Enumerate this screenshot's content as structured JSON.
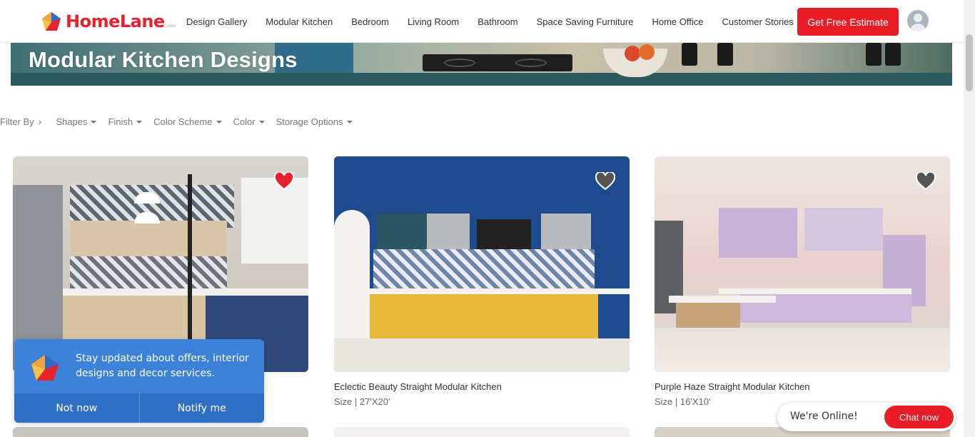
{
  "header": {
    "logo_text": "HomeLane",
    "logo_sub": ".com",
    "nav": [
      "Design Gallery",
      "Modular Kitchen",
      "Bedroom",
      "Living Room",
      "Bathroom",
      "Space Saving Furniture",
      "Home Office",
      "Customer Stories"
    ],
    "cta_label": "Get Free Estimate"
  },
  "hero": {
    "title": "Modular Kitchen Designs"
  },
  "filters": {
    "label": "Filter By",
    "items": [
      "Shapes",
      "Finish",
      "Color Scheme",
      "Color",
      "Storage Options"
    ]
  },
  "cards": [
    {
      "title": "",
      "size": "",
      "favorited": true
    },
    {
      "title": "Eclectic Beauty Straight Modular Kitchen",
      "size": "Size | 27'X20'",
      "favorited": false
    },
    {
      "title": "Purple Haze Straight Modular Kitchen",
      "size": "Size | 16'X10'",
      "favorited": false
    }
  ],
  "notification": {
    "message": "Stay updated about offers, interior designs and decor services.",
    "decline_label": "Not now",
    "accept_label": "Notify me"
  },
  "chat": {
    "status": "We're Online!",
    "button_label": "Chat now"
  },
  "colors": {
    "brand_red": "#e71c24",
    "notify_blue": "#3b82d8",
    "heart_red": "#e8212e",
    "heart_grey": "#555555"
  }
}
